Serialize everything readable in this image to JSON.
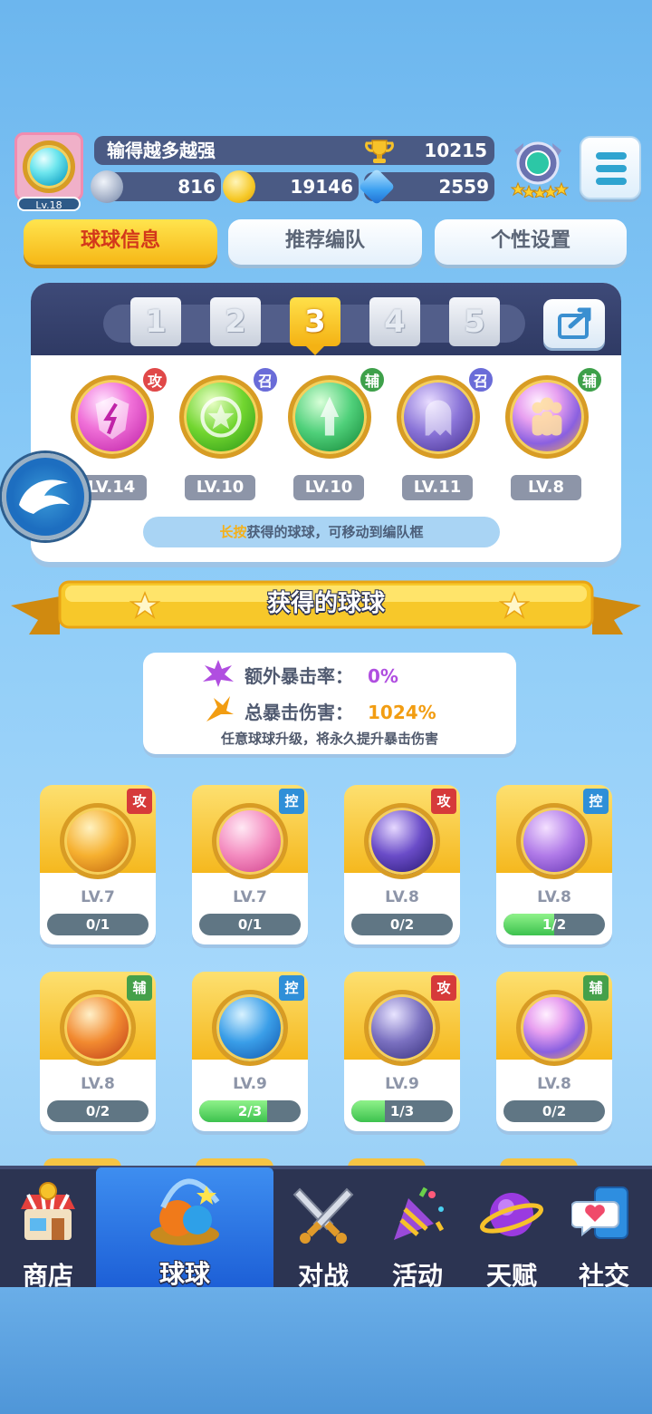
{
  "header": {
    "avatar_level": "Lv.18",
    "player_name": "输得越多越强",
    "trophy_score": "10215",
    "silver_coins": "816",
    "gold_coins": "19146",
    "diamonds": "2559"
  },
  "tabs": [
    {
      "label": "球球信息",
      "active": true
    },
    {
      "label": "推荐编队",
      "active": false
    },
    {
      "label": "个性设置",
      "active": false
    }
  ],
  "team": {
    "slots": [
      "1",
      "2",
      "3",
      "4",
      "5"
    ],
    "active_slot": "3",
    "balls": [
      {
        "tag": "攻",
        "level": "LV.14",
        "tag_color": "#e04848"
      },
      {
        "tag": "召",
        "level": "LV.10",
        "tag_color": "#6a6cd8"
      },
      {
        "tag": "辅",
        "level": "LV.10",
        "tag_color": "#3ea04a"
      },
      {
        "tag": "召",
        "level": "LV.11",
        "tag_color": "#6a6cd8"
      },
      {
        "tag": "辅",
        "level": "LV.8",
        "tag_color": "#3ea04a"
      }
    ],
    "hint_highlight": "长按",
    "hint_rest": "获得的球球，可移动到编队框"
  },
  "section": {
    "title": "获得的球球"
  },
  "crit": {
    "extra_rate_label": "额外暴击率：",
    "extra_rate_value": "0%",
    "total_damage_label": "总暴击伤害：",
    "total_damage_value": "1024%",
    "note": "任意球球升级，将永久提升暴击伤害"
  },
  "owned": [
    {
      "tag": "攻",
      "level": "LV.7",
      "progress": "0/1",
      "fraction": 0
    },
    {
      "tag": "控",
      "level": "LV.7",
      "progress": "0/1",
      "fraction": 0
    },
    {
      "tag": "攻",
      "level": "LV.8",
      "progress": "0/2",
      "fraction": 0
    },
    {
      "tag": "控",
      "level": "LV.8",
      "progress": "1/2",
      "fraction": 0.5
    },
    {
      "tag": "辅",
      "level": "LV.8",
      "progress": "0/2",
      "fraction": 0
    },
    {
      "tag": "控",
      "level": "LV.9",
      "progress": "2/3",
      "fraction": 0.667
    },
    {
      "tag": "攻",
      "level": "LV.9",
      "progress": "1/3",
      "fraction": 0.333
    },
    {
      "tag": "辅",
      "level": "LV.8",
      "progress": "0/2",
      "fraction": 0
    }
  ],
  "tag_colors": {
    "攻": "#d63a3a",
    "控": "#2f8fd8",
    "辅": "#45a04a"
  },
  "nav": [
    {
      "label": "商店",
      "active": false
    },
    {
      "label": "球球",
      "active": true
    },
    {
      "label": "对战",
      "active": false
    },
    {
      "label": "活动",
      "active": false
    },
    {
      "label": "天赋",
      "active": false
    },
    {
      "label": "社交",
      "active": false
    }
  ]
}
